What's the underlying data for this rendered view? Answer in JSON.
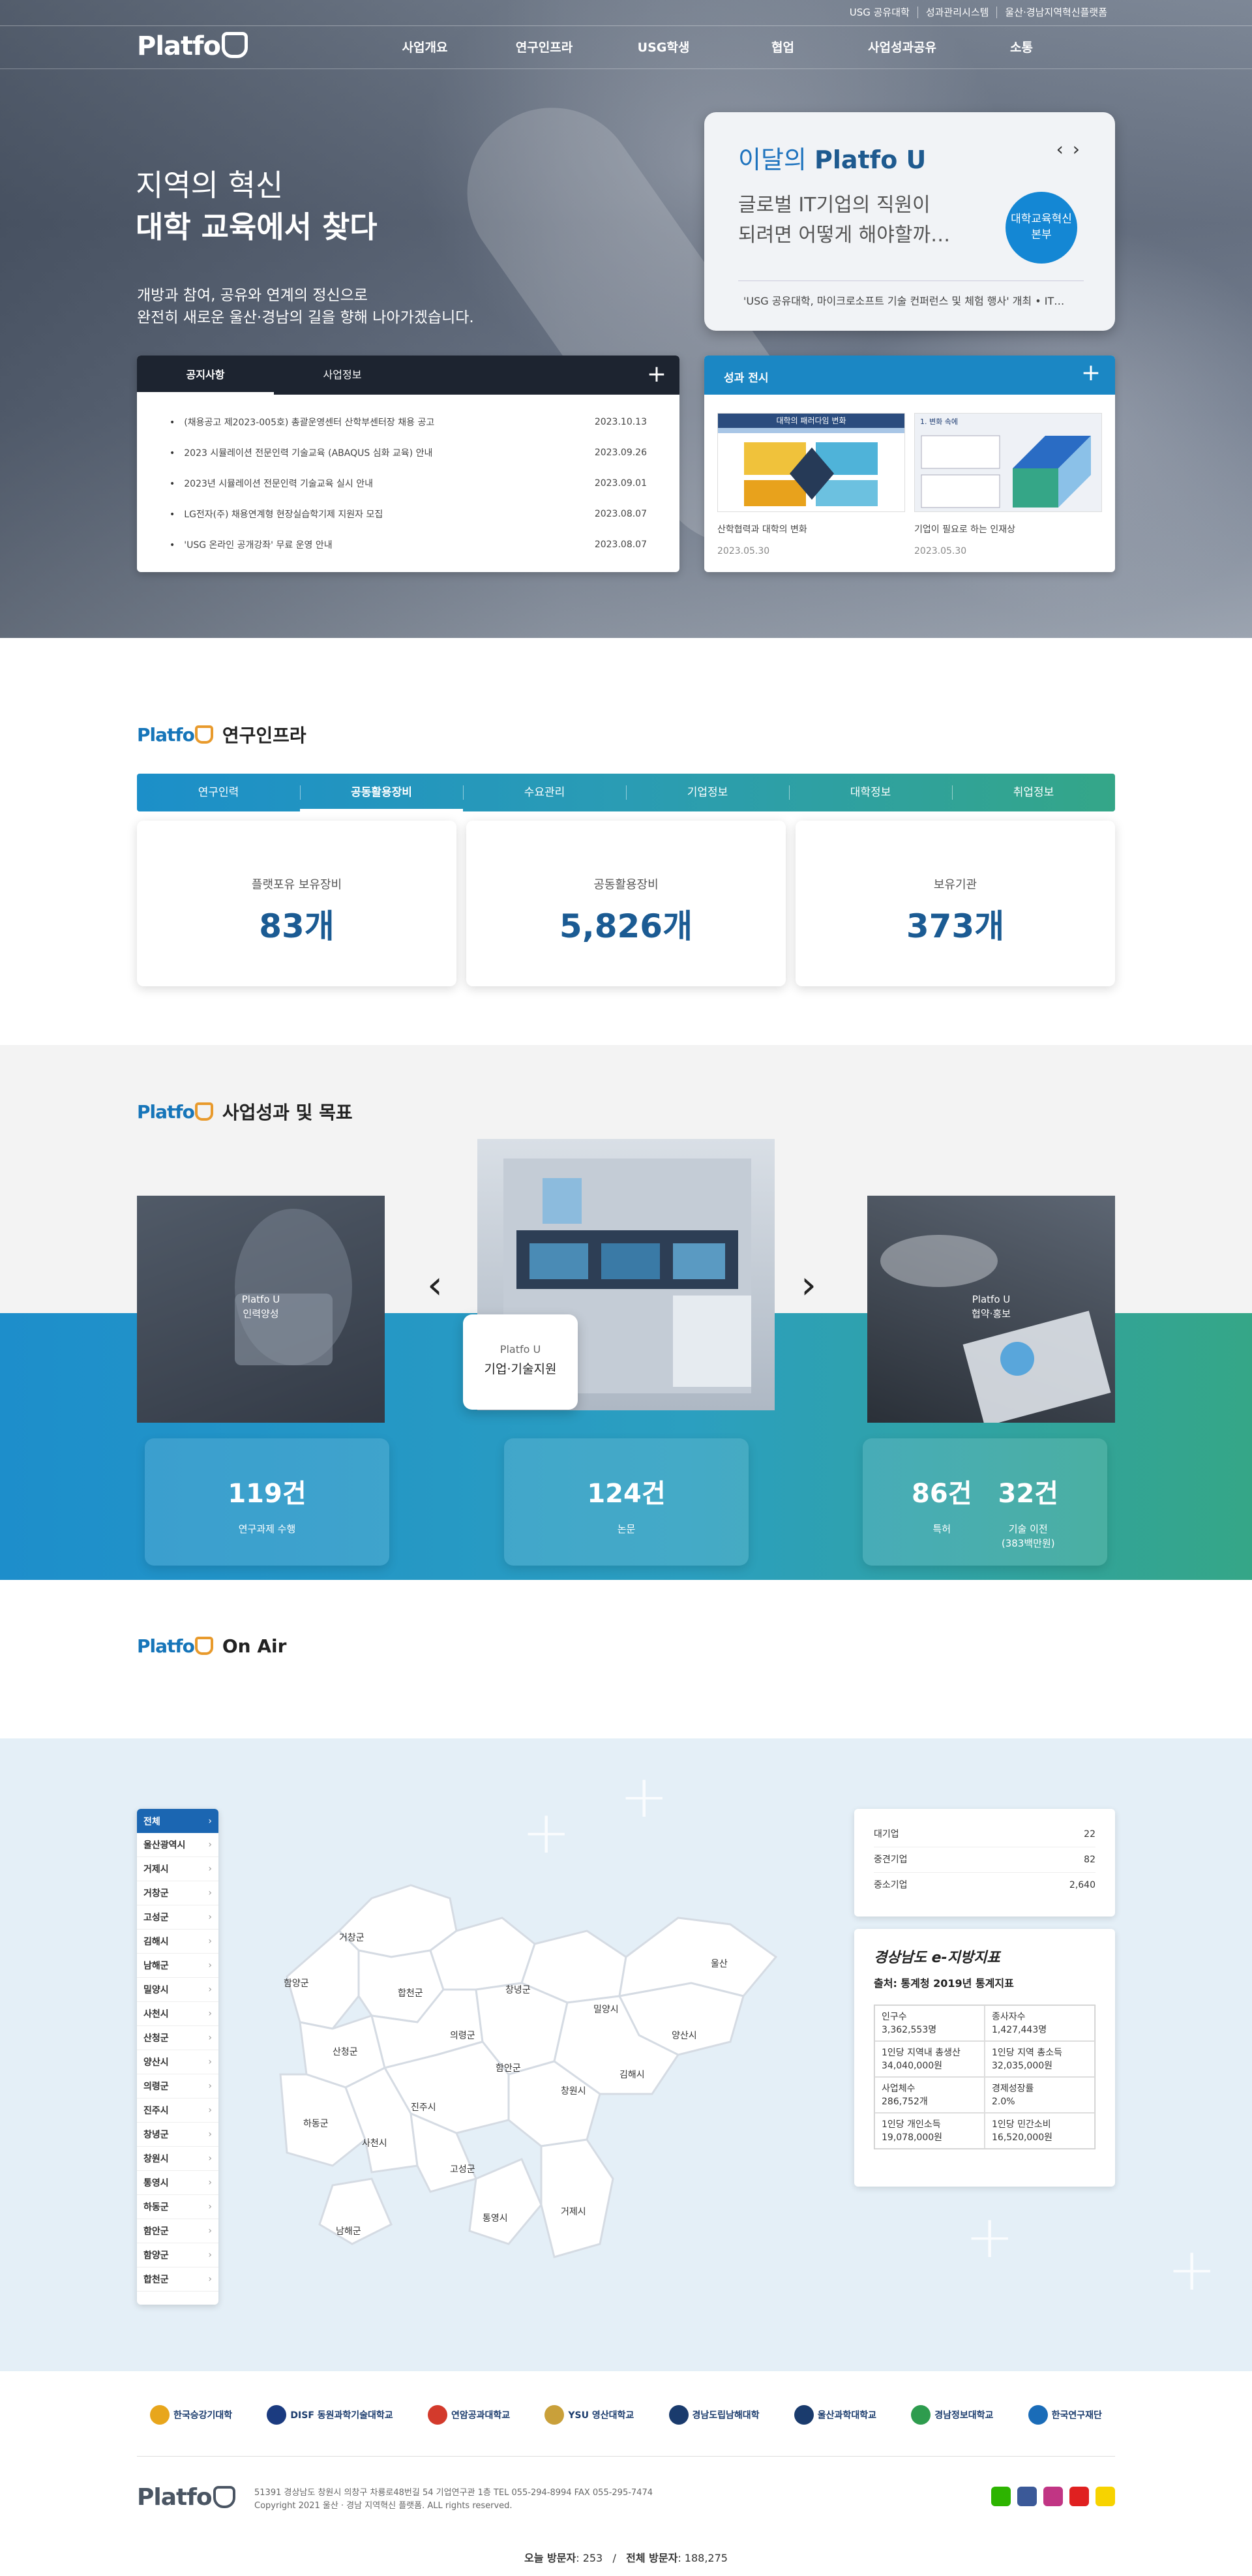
{
  "top_links": [
    "USG 공유대학",
    "성과관리시스템",
    "울산·경남지역혁신플랫폼"
  ],
  "logo": {
    "text": "Platfo",
    "mark": "U"
  },
  "gnb": [
    "사업개요",
    "연구인프라",
    "USG학생",
    "협업",
    "사업성과공유",
    "소통"
  ],
  "hero": {
    "title_line1": "지역의 혁신",
    "title_line2": "대학 교육에서 찾다",
    "desc_line1": "개방과 참여, 공유와 연계의 정신으로",
    "desc_line2": "완전히 새로운 울산·경남의 길을 향해 나아가겠습니다."
  },
  "notice": {
    "tabs": [
      "공지사항",
      "사업정보"
    ],
    "items": [
      {
        "title": "(채용공고 제2023-005호) 총괄운영센터 산학부센터장 채용 공고",
        "date": "2023.10.13"
      },
      {
        "title": "2023 시뮬레이션 전문인력 기술교육 (ABAQUS 심화 교육) 안내",
        "date": "2023.09.26"
      },
      {
        "title": "2023년 시뮬레이션 전문인력 기술교육 실시 안내",
        "date": "2023.09.01"
      },
      {
        "title": "LG전자(주) 채용연계형 현장실습학기제 지원자 모집",
        "date": "2023.08.07"
      },
      {
        "title": "'USG 온라인 공개강좌' 무료 운영 안내",
        "date": "2023.08.07"
      }
    ]
  },
  "monthly": {
    "title_prefix": "이달의",
    "title_brand": "Platfo U",
    "question_line1": "글로벌 IT기업의 직원이",
    "question_line2": "되려면 어떻게 해야할까…",
    "badge_line1": "대학교육혁신",
    "badge_line2": "본부",
    "caption": "'USG 공유대학, 마이크로소프트 기술 컨퍼런스 및 체험 행사' 개최 • IT…"
  },
  "results": {
    "title": "성과 전시",
    "items": [
      {
        "title": "산학협력과 대학의 변화",
        "date": "2023.05.30",
        "thumb_heading": "대학의 패러다임 변화"
      },
      {
        "title": "기업이 필요로 하는 인재상",
        "date": "2023.05.30",
        "thumb_heading": "1. 변화 속에"
      }
    ]
  },
  "infra": {
    "section_title": "연구인프라",
    "tabs": [
      "연구인력",
      "공동활용장비",
      "수요관리",
      "기업정보",
      "대학정보",
      "취업정보"
    ],
    "active_tab": "공동활용장비",
    "stats": [
      {
        "label": "플랫포유 보유장비",
        "value": "83개"
      },
      {
        "label": "공동활용장비",
        "value": "5,826개"
      },
      {
        "label": "보유기관",
        "value": "373개"
      }
    ]
  },
  "biz": {
    "section_title": "사업성과 및 목표",
    "cards": [
      {
        "line1": "Platfo U",
        "line2": "인력양성"
      },
      {
        "line1": "Platfo U",
        "line2": "기업·기술지원"
      },
      {
        "line1": "Platfo U",
        "line2": "협약·홍보"
      }
    ],
    "prev_arrow": "‹",
    "next_arrow": "›",
    "kpis": [
      {
        "value": "119건",
        "label": "연구과제 수행"
      },
      {
        "value": "124건",
        "label": "논문"
      },
      {
        "value": "86건",
        "label": "특허",
        "value2": "32건",
        "label2": "기술 이전",
        "label2b": "(383백만원)"
      }
    ]
  },
  "onair": {
    "section_title": "On Air"
  },
  "map": {
    "regions": [
      "전체",
      "울산광역시",
      "거제시",
      "거창군",
      "고성군",
      "김해시",
      "남해군",
      "밀양시",
      "사천시",
      "산청군",
      "양산시",
      "의령군",
      "진주시",
      "창녕군",
      "창원시",
      "통영시",
      "하동군",
      "함안군",
      "함양군",
      "합천군"
    ],
    "active_region": "전체",
    "labels": [
      "거창군",
      "함양군",
      "합천군",
      "창녕군",
      "밀양시",
      "울산",
      "산청군",
      "의령군",
      "양산시",
      "함안군",
      "김해시",
      "창원시",
      "진주시",
      "하동군",
      "사천시",
      "고성군",
      "남해군",
      "통영시",
      "거제시"
    ],
    "companies": [
      {
        "label": "대기업",
        "value": "22"
      },
      {
        "label": "중견기업",
        "value": "82"
      },
      {
        "label": "중소기업",
        "value": "2,640"
      }
    ],
    "eji": {
      "title": "경상남도 e-지방지표",
      "source": "출처: 통계청 2019년 통계지표",
      "cells": [
        {
          "k": "인구수",
          "v": "3,362,553명"
        },
        {
          "k": "종사자수",
          "v": "1,427,443명"
        },
        {
          "k": "1인당 지역내 총생산",
          "v": "34,040,000원"
        },
        {
          "k": "1인당 지역 총소득",
          "v": "32,035,000원"
        },
        {
          "k": "사업체수",
          "v": "286,752개"
        },
        {
          "k": "경제성장률",
          "v": "2.0%"
        },
        {
          "k": "1인당 개인소득",
          "v": "19,078,000원"
        },
        {
          "k": "1인당 민간소비",
          "v": "16,520,000원"
        }
      ]
    }
  },
  "partners": [
    {
      "name": "한국승강기대학",
      "color": "#e8a61c"
    },
    {
      "name": "DISF 동원과학기술대학교",
      "color": "#1b3b80"
    },
    {
      "name": "연암공과대학교",
      "color": "#d33a2c"
    },
    {
      "name": "YSU 영산대학교",
      "color": "#c9a03a"
    },
    {
      "name": "경남도립남해대학",
      "color": "#1a3b6d"
    },
    {
      "name": "울산과학대학교",
      "color": "#1a3b6d"
    },
    {
      "name": "경남정보대학교",
      "color": "#2e9c4e"
    },
    {
      "name": "한국연구재단",
      "color": "#1a6cb8"
    }
  ],
  "footer": {
    "address": "51391 경상남도 창원시 의창구 차룡로48번길 54 기업연구관 1층 TEL 055-294-8994 FAX 055-295-7474",
    "copyright": "Copyright 2021 울산 · 경남 지역혁신 플랫폼. ALL rights reserved.",
    "logo_sub": "Platfo U",
    "today_label": "오늘 방문자",
    "today_value": "253",
    "total_label": "전체 방문자",
    "total_value": "188,275"
  },
  "colors": {
    "brand_blue": "#1675b9",
    "brand_orange": "#e89a2c",
    "teal": "#35a687",
    "navy": "#1b5b93"
  }
}
